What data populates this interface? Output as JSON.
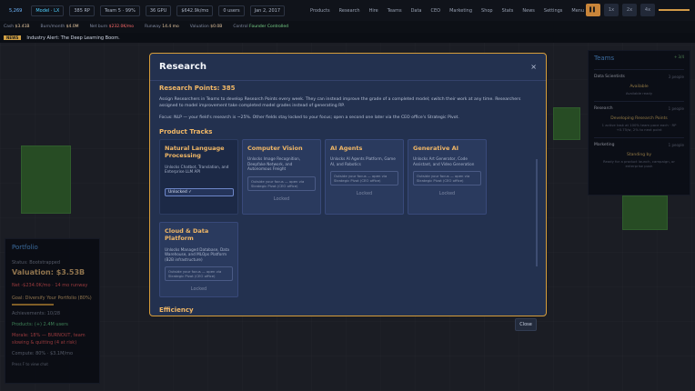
{
  "topbar": {
    "chips": [
      "5,269",
      "Model · LX",
      "385 RP",
      "Team 5 · 99%",
      "36 GPU",
      "$642.9k/mo",
      "0 users",
      "Jan 2, 2017"
    ],
    "nav": [
      "Products",
      "Research",
      "Hire",
      "Teams",
      "Data",
      "CEO",
      "Marketing",
      "Shop",
      "Stats",
      "News",
      "Settings",
      "Menu"
    ],
    "speed": [
      "▌▌",
      "1x",
      "2x",
      "4x"
    ]
  },
  "stats2": {
    "items": [
      {
        "label": "Cash",
        "value": "$3.41B"
      },
      {
        "label": "Burn/month",
        "value": "$4.0M"
      },
      {
        "label": "Net burn",
        "value": "$232.0K/mo"
      },
      {
        "label": "Runway",
        "value": "14.4 mo"
      },
      {
        "label": "Valuation",
        "value": "$0.0B"
      },
      {
        "label": "Control",
        "value": "Founder Controlled"
      }
    ]
  },
  "news": {
    "tag": "NEWS",
    "text": "Industry Alert: The Deep Learning Boom."
  },
  "portfolio": {
    "title": "Portfolio",
    "status": "Status: Bootstrapped",
    "valuation": "Valuation: $3.53B",
    "burn": "Net -$234.0K/mo · 14 mo runway",
    "goal": "Goal: Diversify Your Portfolio (80%)",
    "achievements": "Achievements: 10/28",
    "products": "Products: (+) 2.4M users",
    "morale": "Morale: 18% — BURNOUT, team slowing & quitting (4 at risk)",
    "compute": "Compute: 80% · $3.1M/mo",
    "footer": "Press F to view chat"
  },
  "teams": {
    "title": "Teams",
    "badge": "+ 3/4",
    "cards": [
      {
        "name": "Data Scientists",
        "count": "3 people",
        "status": "Available",
        "sub": "Available ready"
      },
      {
        "name": "Research",
        "count": "1 people",
        "status": "Developing Research Points",
        "sub": "1 active task at 100% team pace each · RP +0.75/w, 2% to next point"
      },
      {
        "name": "Marketing",
        "count": "1 people",
        "status": "Standing by",
        "sub": "Ready for a product launch, campaign, or enterprise push"
      }
    ]
  },
  "modal": {
    "title": "Research",
    "close_icon": "×",
    "rp": "Research Points: 385",
    "desc1": "Assign Researchers in Teams to develop Research Points every week. They can instead improve the grade of a completed model; switch their work at any time. Researchers assigned to model improvement take completed model grades instead of generating RP.",
    "desc2": "Focus: NLP — your field's research is ~25%. Other fields stay locked to your focus; open a second one later via the CEO office's Strategic Pivot.",
    "section_tracks": "Product Tracks",
    "section_efficiency": "Efficiency",
    "tracks": [
      {
        "name": "Natural Language Processing",
        "desc": "Unlocks Chatbot, Translation, and Enterprise LLM API",
        "state": "unlocked",
        "badge": "Unlocked ✓"
      },
      {
        "name": "Computer Vision",
        "desc": "Unlocks Image Recognition, Deepfake Network, and Autonomous Freight",
        "state": "locked",
        "lockbox": "Outside your focus — open via Strategic Pivot (CEO office)",
        "locked": "Locked"
      },
      {
        "name": "AI Agents",
        "desc": "Unlocks AI Agents Platform, Game AI, and Robotics",
        "state": "locked",
        "lockbox": "Outside your focus — open via Strategic Pivot (CEO office)",
        "locked": "Locked"
      },
      {
        "name": "Generative AI",
        "desc": "Unlocks Art Generator, Code Assistant, and Video Generation",
        "state": "locked",
        "lockbox": "Outside your focus — open via Strategic Pivot (CEO office)",
        "locked": "Locked"
      },
      {
        "name": "Cloud & Data Platform",
        "desc": "Unlocks Managed Database, Data Warehouse, and MLOps Platform (B2B infrastructure)",
        "state": "locked",
        "lockbox": "Outside your focus — open via Strategic Pivot (CEO office)",
        "locked": "Locked"
      }
    ],
    "close_button": "Close"
  }
}
